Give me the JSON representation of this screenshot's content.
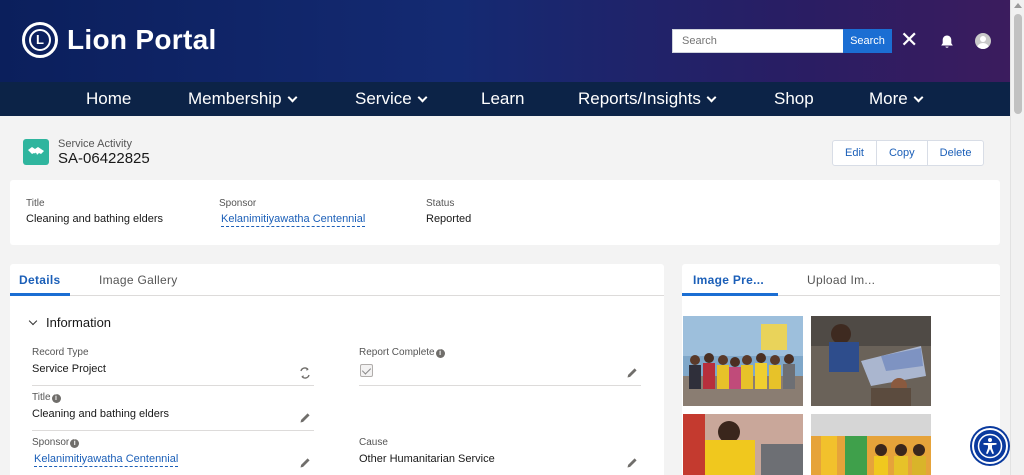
{
  "header": {
    "brand": "Lion Portal",
    "search_placeholder": "Search",
    "search_button": "Search",
    "close_glyph": "✕"
  },
  "nav": {
    "items": [
      {
        "label": "Home",
        "dropdown": false
      },
      {
        "label": "Membership",
        "dropdown": true
      },
      {
        "label": "Service",
        "dropdown": true
      },
      {
        "label": "Learn",
        "dropdown": false
      },
      {
        "label": "Reports/Insights",
        "dropdown": true
      },
      {
        "label": "Shop",
        "dropdown": false
      },
      {
        "label": "More",
        "dropdown": true
      }
    ]
  },
  "record": {
    "type": "Service Activity",
    "number": "SA-06422825",
    "actions": [
      "Edit",
      "Copy",
      "Delete"
    ]
  },
  "summary": {
    "title_label": "Title",
    "title_value": "Cleaning and bathing elders",
    "sponsor_label": "Sponsor",
    "sponsor_value": "Kelanimitiyawatha Centennial",
    "status_label": "Status",
    "status_value": "Reported"
  },
  "details": {
    "tabs": [
      "Details",
      "Image Gallery"
    ],
    "section": "Information",
    "record_type_label": "Record Type",
    "record_type_value": "Service Project",
    "report_complete_label": "Report Complete",
    "report_complete_checked": true,
    "title_label": "Title",
    "title_value": "Cleaning and bathing elders",
    "sponsor_label": "Sponsor",
    "sponsor_value": "Kelanimitiyawatha Centennial",
    "cause_label": "Cause",
    "cause_value": "Other Humanitarian Service"
  },
  "images": {
    "tabs": [
      "Image Pre...",
      "Upload Im..."
    ]
  },
  "colors": {
    "link": "#1b5fb8",
    "accent": "#1b6ed3",
    "nav_bg": "#0c2347",
    "record_icon": "#2fb59e"
  }
}
